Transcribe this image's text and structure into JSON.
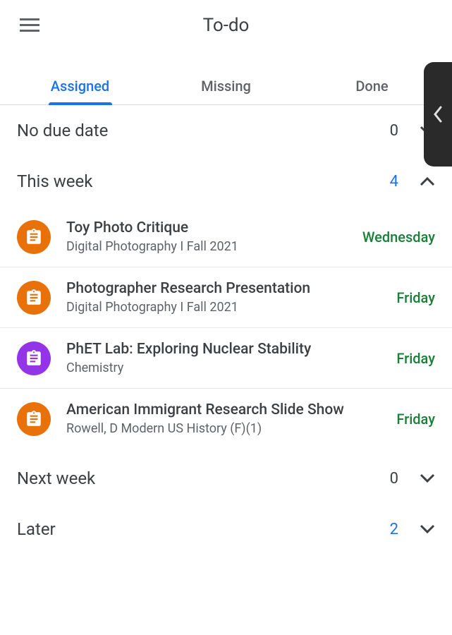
{
  "header": {
    "title": "To-do"
  },
  "tabs": {
    "assigned": "Assigned",
    "missing": "Missing",
    "done": "Done"
  },
  "sections": {
    "noDueDate": {
      "title": "No due date",
      "count": "0"
    },
    "thisWeek": {
      "title": "This week",
      "count": "4"
    },
    "nextWeek": {
      "title": "Next week",
      "count": "0"
    },
    "later": {
      "title": "Later",
      "count": "2"
    }
  },
  "assignments": [
    {
      "title": "Toy Photo Critique",
      "class": "Digital Photography I Fall 2021",
      "due": "Wednesday",
      "color": "orange"
    },
    {
      "title": "Photographer Research Presentation",
      "class": "Digital Photography I Fall 2021",
      "due": "Friday",
      "color": "orange"
    },
    {
      "title": "PhET Lab: Exploring Nuclear Stability",
      "class": "Chemistry",
      "due": "Friday",
      "color": "purple"
    },
    {
      "title": "American Immigrant Research Slide Show",
      "class": "Rowell, D  Modern US History (F)(1)",
      "due": "Friday",
      "color": "orange"
    }
  ]
}
